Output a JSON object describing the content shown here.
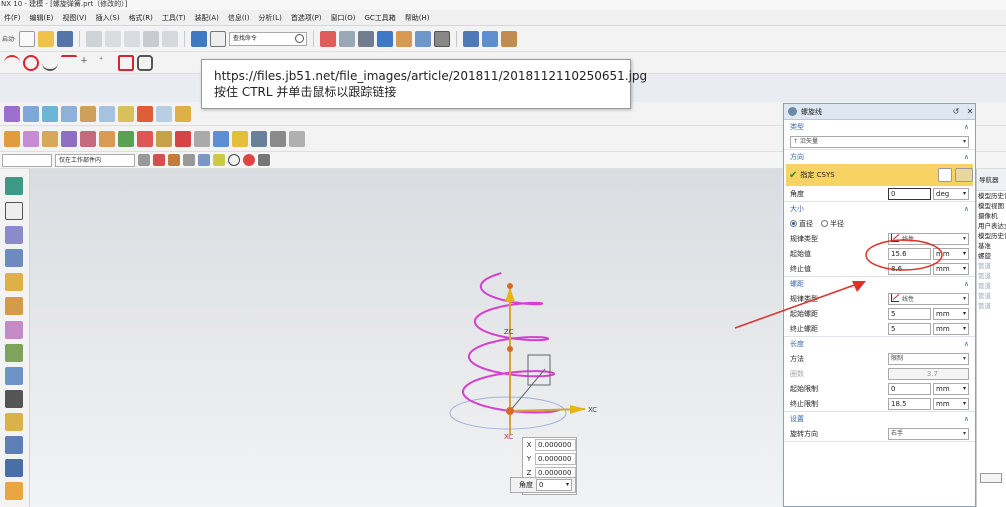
{
  "app": {
    "title": "NX 10 - 建模 - [螺旋弹簧.prt（修改的）]"
  },
  "menu": [
    "件(F)",
    "编辑(E)",
    "视图(V)",
    "插入(S)",
    "格式(R)",
    "工具(T)",
    "装配(A)",
    "信息(I)",
    "分析(L)",
    "首选项(P)",
    "窗口(O)",
    "GC工具箱",
    "帮助(H)"
  ],
  "toolbar": {
    "start_label": "启动·",
    "command_search_placeholder": "查找命令"
  },
  "selection_bar": {
    "filter_value": "",
    "scope_value": "仅在工作部件内"
  },
  "tooltip": {
    "url": "https://files.jb51.net/file_images/article/201811/2018112110250651.jpg",
    "hint": "按住 CTRL 并单击鼠标以跟踪链接"
  },
  "viewport": {
    "coords": {
      "x_label": "X",
      "y_label": "Y",
      "z_label": "Z",
      "x": "0.000000",
      "y": "0.000000",
      "z": "0.000000"
    },
    "angle_label": "角度",
    "angle_value": "0"
  },
  "dialog": {
    "title": "螺旋线",
    "type": {
      "header": "类型",
      "value": "沿矢量"
    },
    "direction": {
      "header": "方向",
      "csys_label": "指定 CSYS",
      "angle_label": "角度",
      "angle_value": "0",
      "angle_unit": "deg"
    },
    "size": {
      "header": "大小",
      "radio_diameter": "直径",
      "radio_radius": "半径",
      "law_label": "规律类型",
      "law_value": "线性",
      "start_label": "起始值",
      "start_value": "15.6",
      "start_unit": "mm",
      "end_label": "终止值",
      "end_value": "8.6",
      "end_unit": "mm"
    },
    "pitch": {
      "header": "螺距",
      "law_label": "规律类型",
      "law_value": "线性",
      "start_label": "起始螺距",
      "start_value": "5",
      "start_unit": "mm",
      "end_label": "终止螺距",
      "end_value": "5",
      "end_unit": "mm"
    },
    "length": {
      "header": "长度",
      "method_label": "方法",
      "method_value": "限制",
      "turns_label": "圈数",
      "turns_value": "3.7",
      "start_label": "起始限制",
      "start_value": "0",
      "start_unit": "mm",
      "end_label": "终止限制",
      "end_value": "18.5",
      "end_unit": "mm"
    },
    "settings": {
      "header": "设置",
      "rotation_label": "旋转方向",
      "rotation_value": "右手"
    }
  },
  "navigator": {
    "header": "导航器",
    "items": [
      "模型历史记录",
      "模型视图",
      "摄像机",
      "用户表达式",
      "模型历史记录",
      "基准",
      "螺旋",
      "管道",
      "管道",
      "管道",
      "管道",
      "管道"
    ]
  },
  "colors": {
    "helix": "#d63fcf",
    "annotation": "#e0302a",
    "axis_yellow": "#e7b416",
    "csys_highlight": "#f6d363",
    "section_header": "#3a66a8"
  }
}
